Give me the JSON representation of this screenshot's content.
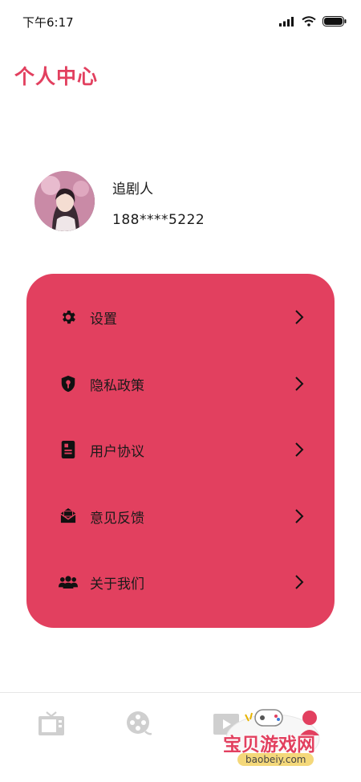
{
  "status_bar": {
    "time": "下午6:17"
  },
  "page_title": "个人中心",
  "profile": {
    "name": "追剧人",
    "phone": "188****5222"
  },
  "menu": {
    "items": [
      {
        "label": "设置",
        "icon": "gear-icon"
      },
      {
        "label": "隐私政策",
        "icon": "shield-lock-icon"
      },
      {
        "label": "用户协议",
        "icon": "document-icon"
      },
      {
        "label": "意见反馈",
        "icon": "envelope-icon"
      },
      {
        "label": "关于我们",
        "icon": "users-icon"
      }
    ]
  },
  "tab_bar": {
    "tabs": [
      {
        "icon": "tv-icon"
      },
      {
        "icon": "film-reel-icon"
      },
      {
        "icon": "video-play-icon"
      }
    ]
  },
  "watermark": {
    "text": "宝贝游戏网",
    "url": "baobeiy.com"
  },
  "colors": {
    "accent": "#e2405f",
    "tab_icon": "#cfcfcf",
    "text": "#1a1a1a"
  }
}
